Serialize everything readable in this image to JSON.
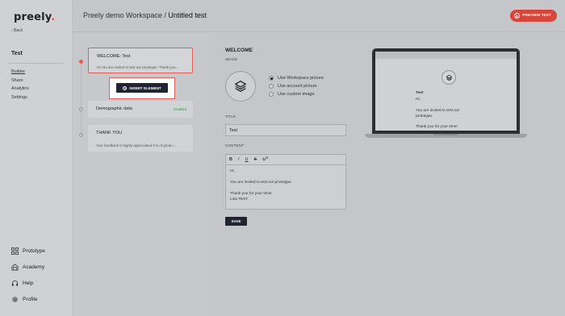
{
  "sidebar": {
    "logo": "preely",
    "logo_dot": ".",
    "back": "Back",
    "project": "Test",
    "nav": [
      "Builder",
      "Share",
      "Analytics",
      "Settings"
    ],
    "bottom": [
      {
        "label": "Prototype",
        "icon": "grid-icon"
      },
      {
        "label": "Academy",
        "icon": "academy-icon"
      },
      {
        "label": "Help",
        "icon": "headset-icon"
      },
      {
        "label": "Profile",
        "icon": "gear-icon"
      }
    ]
  },
  "header": {
    "workspace": "Preely demo Workspace /",
    "test_title": "Untitled test",
    "preview_button": "PREVIEW TEST"
  },
  "builder": {
    "cards": [
      {
        "title": "WELCOME:  Test",
        "sub": "Hi,You are invited to test our prototype. Thank you..."
      },
      {
        "title": "Demographic data",
        "badge": "Enabled"
      },
      {
        "title": "THANK YOU",
        "sub": "Your feedback is highly appreciated.It is of great i..."
      }
    ],
    "insert_button": "INSERT ELEMENT"
  },
  "editor": {
    "heading": "WELCOME",
    "image_label": "IMAGE",
    "image_options": [
      "Use Workspace picture",
      "Use account picture",
      "Use custom image"
    ],
    "selected_option": "Use Workspace picture",
    "title_label": "TITLE",
    "title_value": "Test",
    "content_label": "CONTENT",
    "toolbar": [
      "B",
      "I",
      "U",
      "S"
    ],
    "content_lines": [
      "Hi,",
      "",
      "You are invited to test our prototype.",
      "",
      "Thank you for your time!",
      "Lisa TEST"
    ],
    "save_button": "SAVE"
  },
  "preview": {
    "title": "Test",
    "lines": [
      "Hi,",
      "You are invited to test our",
      "prototype.",
      "Thank you for your time!"
    ]
  },
  "colors": {
    "accent": "#e25d55",
    "dark_button": "#1f2430",
    "enabled": "#2e9e4b"
  }
}
